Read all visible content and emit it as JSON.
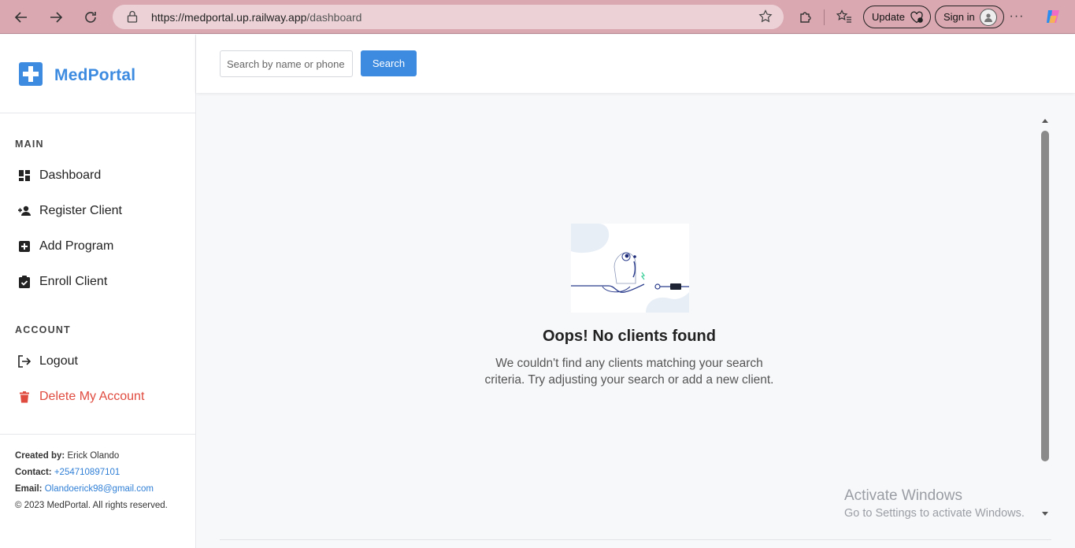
{
  "browser": {
    "url_host": "https://medportal.up.railway.app",
    "url_path": "/dashboard",
    "update_label": "Update",
    "signin_label": "Sign in"
  },
  "brand": {
    "name": "MedPortal",
    "color": "#3d8be0"
  },
  "sidebar": {
    "main_title": "MAIN",
    "main_items": [
      {
        "label": "Dashboard",
        "icon": "dashboard-icon"
      },
      {
        "label": "Register Client",
        "icon": "person-add-icon"
      },
      {
        "label": "Add Program",
        "icon": "plus-square-icon"
      },
      {
        "label": "Enroll Client",
        "icon": "clipboard-check-icon"
      }
    ],
    "account_title": "ACCOUNT",
    "account_items": [
      {
        "label": "Logout",
        "icon": "logout-icon"
      },
      {
        "label": "Delete My Account",
        "icon": "trash-icon",
        "color": "#e04b3f"
      }
    ]
  },
  "footer": {
    "created_by_label": "Created by:",
    "created_by": "Erick Olando",
    "contact_label": "Contact:",
    "contact": "+254710897101",
    "email_label": "Email:",
    "email": "Olandoerick98@gmail.com",
    "copyright": "© 2023 MedPortal. All rights reserved."
  },
  "search": {
    "placeholder": "Search by name or phone",
    "button_label": "Search"
  },
  "empty_state": {
    "title": "Oops! No clients found",
    "message": "We couldn't find any clients matching your search criteria. Try adjusting your search or add a new client."
  },
  "watermark": {
    "line1": "Activate Windows",
    "line2": "Go to Settings to activate Windows."
  }
}
